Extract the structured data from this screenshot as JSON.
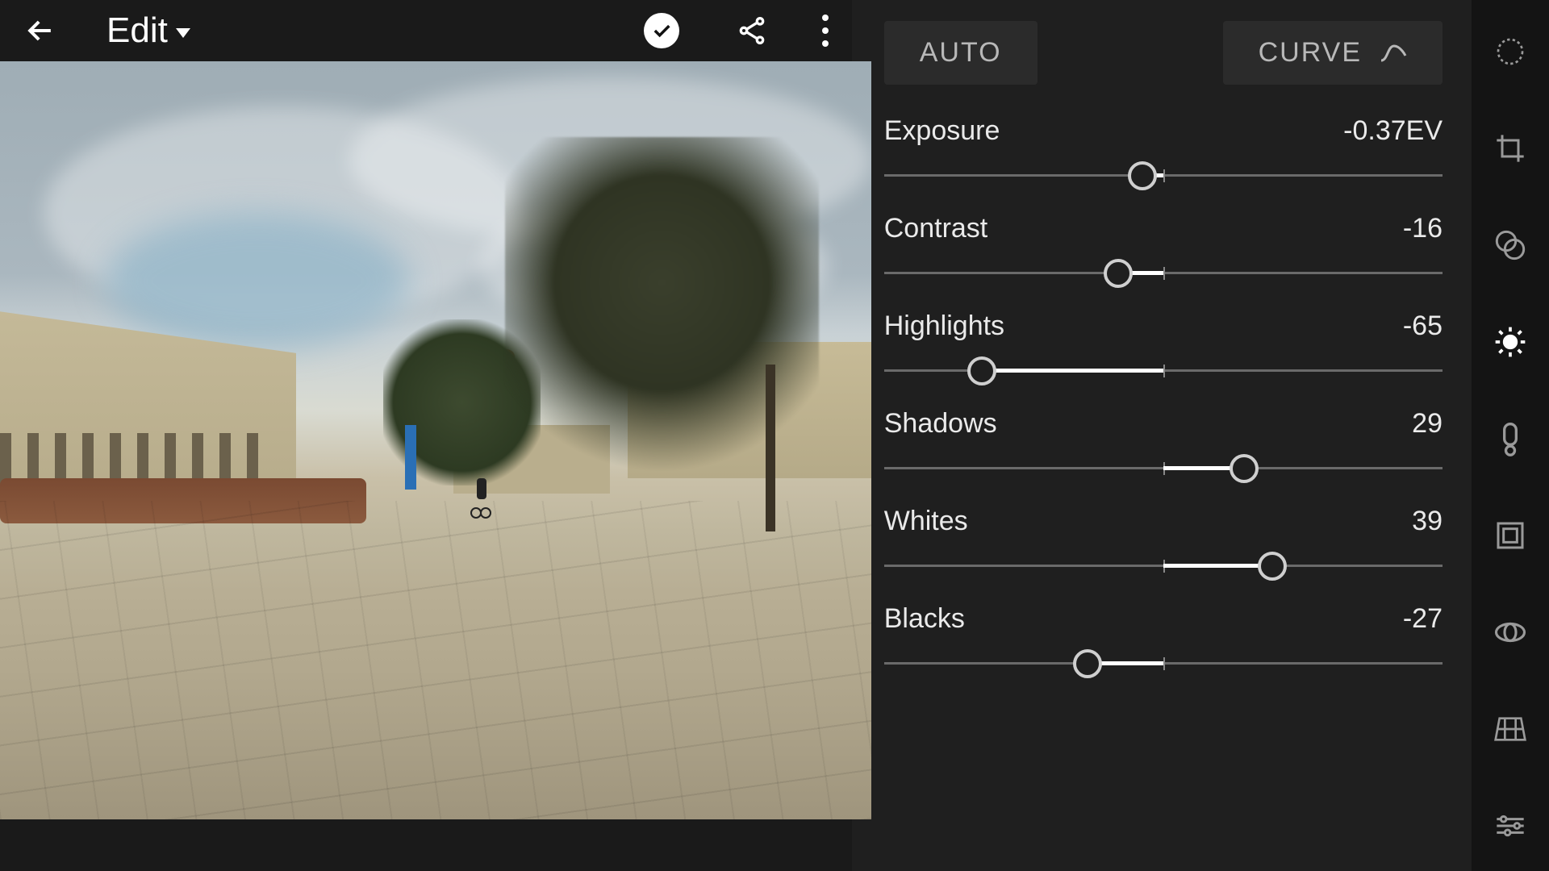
{
  "header": {
    "title": "Edit"
  },
  "panel": {
    "auto_label": "AUTO",
    "curve_label": "CURVE"
  },
  "sliders": {
    "exposure": {
      "label": "Exposure",
      "value_text": "-0.37EV",
      "min": -5,
      "max": 5,
      "value": -0.37
    },
    "contrast": {
      "label": "Contrast",
      "value_text": "-16",
      "min": -100,
      "max": 100,
      "value": -16
    },
    "highlights": {
      "label": "Highlights",
      "value_text": "-65",
      "min": -100,
      "max": 100,
      "value": -65
    },
    "shadows": {
      "label": "Shadows",
      "value_text": "29",
      "min": -100,
      "max": 100,
      "value": 29
    },
    "whites": {
      "label": "Whites",
      "value_text": "39",
      "min": -100,
      "max": 100,
      "value": 39
    },
    "blacks": {
      "label": "Blacks",
      "value_text": "-27",
      "min": -100,
      "max": 100,
      "value": -27
    }
  },
  "tools": [
    {
      "name": "healing",
      "active": false
    },
    {
      "name": "crop",
      "active": false
    },
    {
      "name": "presets",
      "active": false
    },
    {
      "name": "light",
      "active": true
    },
    {
      "name": "color-wb",
      "active": false
    },
    {
      "name": "vignette",
      "active": false
    },
    {
      "name": "lens",
      "active": false
    },
    {
      "name": "geometry",
      "active": false
    },
    {
      "name": "settings",
      "active": false
    }
  ]
}
